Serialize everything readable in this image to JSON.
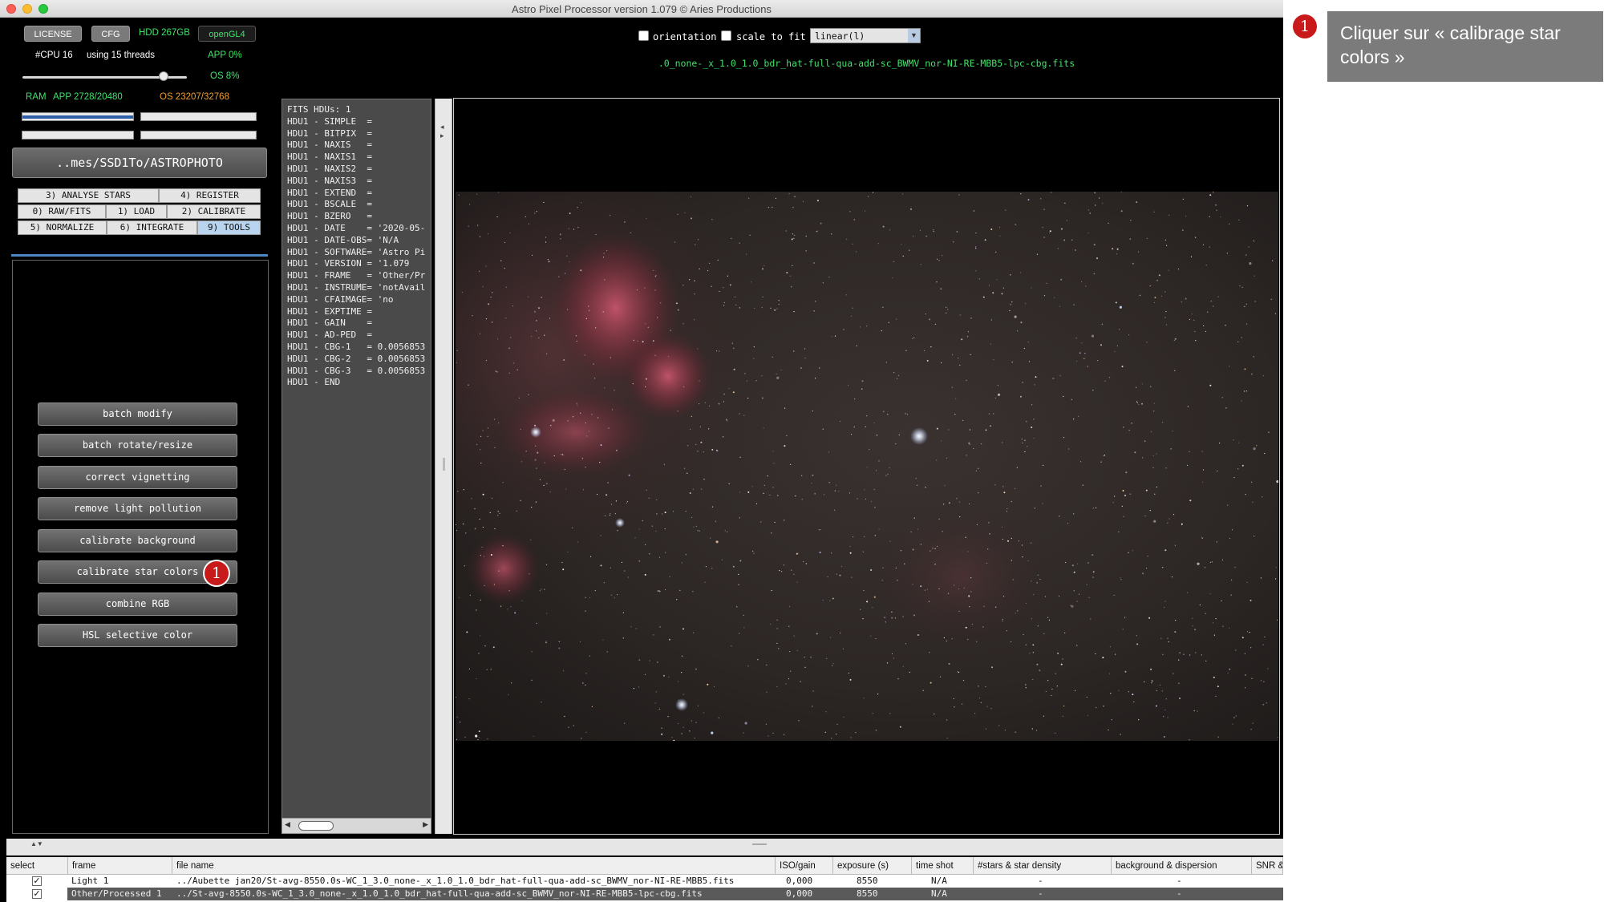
{
  "window": {
    "title": "Astro Pixel Processor version 1.079 © Aries Productions"
  },
  "top_left": {
    "license_label": "LICENSE",
    "cfg_label": "CFG",
    "hdd_label": "HDD 267GB",
    "opengl_label": "openGL4",
    "cpu_label": "#CPU 16",
    "threads_label": "using 15 threads",
    "app_cpu": "APP 0%",
    "os_cpu": "OS 8%",
    "ram_label": "RAM",
    "ram_app": "APP 2728/20480",
    "ram_os": "OS 23207/32768",
    "thread_slider_level": 0.88,
    "path_label": "..mes/SSD1To/ASTROPHOTO"
  },
  "tabs": [
    {
      "label": "3) ANALYSE STARS"
    },
    {
      "label": "4) REGISTER"
    },
    {
      "label": "0) RAW/FITS"
    },
    {
      "label": "1) LOAD"
    },
    {
      "label": "2) CALIBRATE"
    },
    {
      "label": "5) NORMALIZE"
    },
    {
      "label": "6) INTEGRATE"
    },
    {
      "label": "9) TOOLS"
    }
  ],
  "tools": [
    {
      "label": "batch modify"
    },
    {
      "label": "batch rotate/resize"
    },
    {
      "label": "correct vignetting"
    },
    {
      "label": "remove light pollution"
    },
    {
      "label": "calibrate background"
    },
    {
      "label": "calibrate star colors"
    },
    {
      "label": "combine RGB"
    },
    {
      "label": "HSL selective color"
    }
  ],
  "viewer": {
    "orientation_label": "orientation",
    "scale_label": "scale to fit",
    "stretch_value": "linear(l)",
    "filename": ".0_none-_x_1.0_1.0_bdr_hat-full-qua-add-sc_BWMV_nor-NI-RE-MBB5-lpc-cbg.fits"
  },
  "fits_header": [
    "FITS HDUs: 1",
    "HDU1 - SIMPLE  =",
    "HDU1 - BITPIX  =",
    "HDU1 - NAXIS   =",
    "HDU1 - NAXIS1  =",
    "HDU1 - NAXIS2  =",
    "HDU1 - NAXIS3  =",
    "HDU1 - EXTEND  =",
    "HDU1 - BSCALE  =",
    "HDU1 - BZERO   =",
    "HDU1 - DATE    = '2020-05-",
    "HDU1 - DATE-OBS= 'N/A",
    "HDU1 - SOFTWARE= 'Astro Pi",
    "HDU1 - VERSION = '1.079",
    "HDU1 - FRAME   = 'Other/Pr",
    "HDU1 - INSTRUME= 'notAvail",
    "HDU1 - CFAIMAGE= 'no",
    "HDU1 - EXPTIME =",
    "HDU1 - GAIN    =",
    "HDU1 - AD-PED  =",
    "HDU1 - CBG-1   = 0.0056853",
    "HDU1 - CBG-2   = 0.0056853",
    "HDU1 - CBG-3   = 0.0056853",
    "HDU1 - END"
  ],
  "table": {
    "headers": [
      "select",
      "frame",
      "file name",
      "ISO/gain",
      "exposure (s)",
      "time shot",
      "#stars & star density",
      "background & dispersion",
      "SNR &"
    ],
    "rows": [
      {
        "frame": "Light 1",
        "file": "../Aubette jan20/St-avg-8550.0s-WC_1_3.0_none-_x_1.0_1.0_bdr_hat-full-qua-add-sc_BWMV_nor-NI-RE-MBB5.fits",
        "iso": "0,000",
        "exposure": "8550",
        "time": "N/A",
        "stars": "-",
        "bg": "-"
      },
      {
        "frame": "Other/Processed 1",
        "file": "../St-avg-8550.0s-WC_1_3.0_none-_x_1.0_1.0_bdr_hat-full-qua-add-sc_BWMV_nor-NI-RE-MBB5-lpc-cbg.fits",
        "iso": "0,000",
        "exposure": "8550",
        "time": "N/A",
        "stars": "-",
        "bg": "-"
      }
    ]
  },
  "annotation": {
    "badge": "1",
    "text": "Cliquer sur « calibrage star colors »"
  },
  "colors": {
    "accent_green": "#3fe36a",
    "os_orange": "#f0a030",
    "badge_red": "#c81a1a"
  }
}
